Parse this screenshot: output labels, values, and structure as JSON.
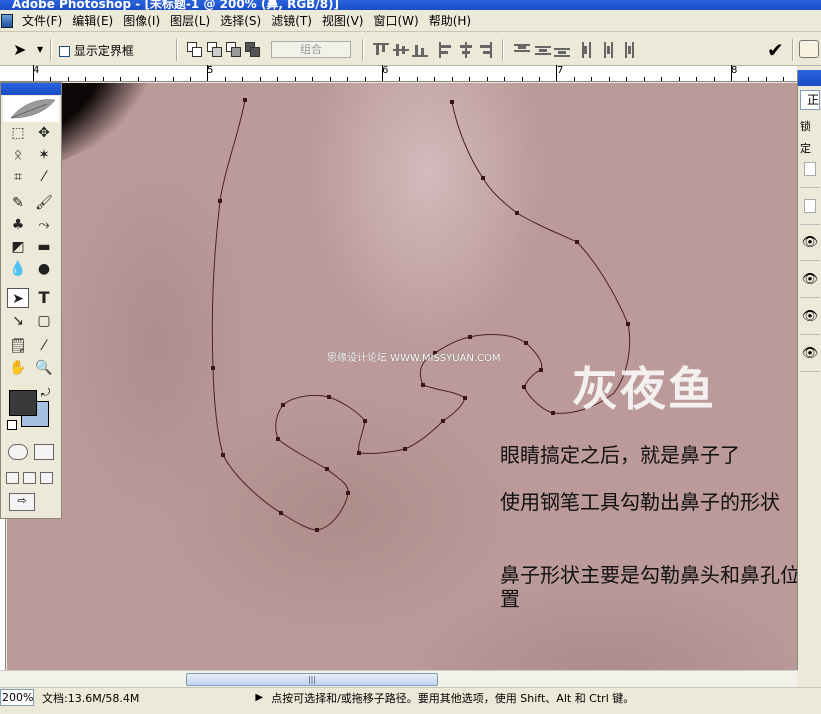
{
  "window": {
    "title": "Adobe Photoshop - [未标题-1 @ 200% (鼻, RGB/8)]"
  },
  "menu": {
    "items": [
      "文件(F)",
      "编辑(E)",
      "图像(I)",
      "图层(L)",
      "选择(S)",
      "滤镜(T)",
      "视图(V)",
      "窗口(W)",
      "帮助(H)"
    ]
  },
  "options": {
    "show_bounding_box_label": "显示定界框",
    "combine_label": "组合"
  },
  "ruler": {
    "labels": [
      "4",
      "5",
      "6",
      "7",
      "8"
    ]
  },
  "canvas": {
    "watermark_site": "思缘设计论坛  WWW.MISSYUAN.COM",
    "watermark_brand": "灰夜鱼",
    "caption_1": "眼睛搞定之后，就是鼻子了",
    "caption_2": "使用钢笔工具勾勒出鼻子的形状",
    "caption_3": "鼻子形状主要是勾勒鼻头和鼻孔位置"
  },
  "right_panel": {
    "blend_mode_partial": "正",
    "lock_label_partial": "锁定"
  },
  "status": {
    "zoom": "200%",
    "doc_size": "文档:13.6M/58.4M",
    "hint": "点按可选择和/或拖移子路径。要用其他选项，使用 Shift、Alt 和 Ctrl 键。"
  },
  "colors": {
    "skin": "#bb9a99",
    "path_stroke": "#4a2323",
    "foreground": "#3a3a3a",
    "background": "#a8c0e0",
    "title_blue": "#2a63e0"
  },
  "icons": {
    "commit": "check-icon",
    "palette_well": "folder-icon",
    "layer_visibility": "eye-icon"
  }
}
